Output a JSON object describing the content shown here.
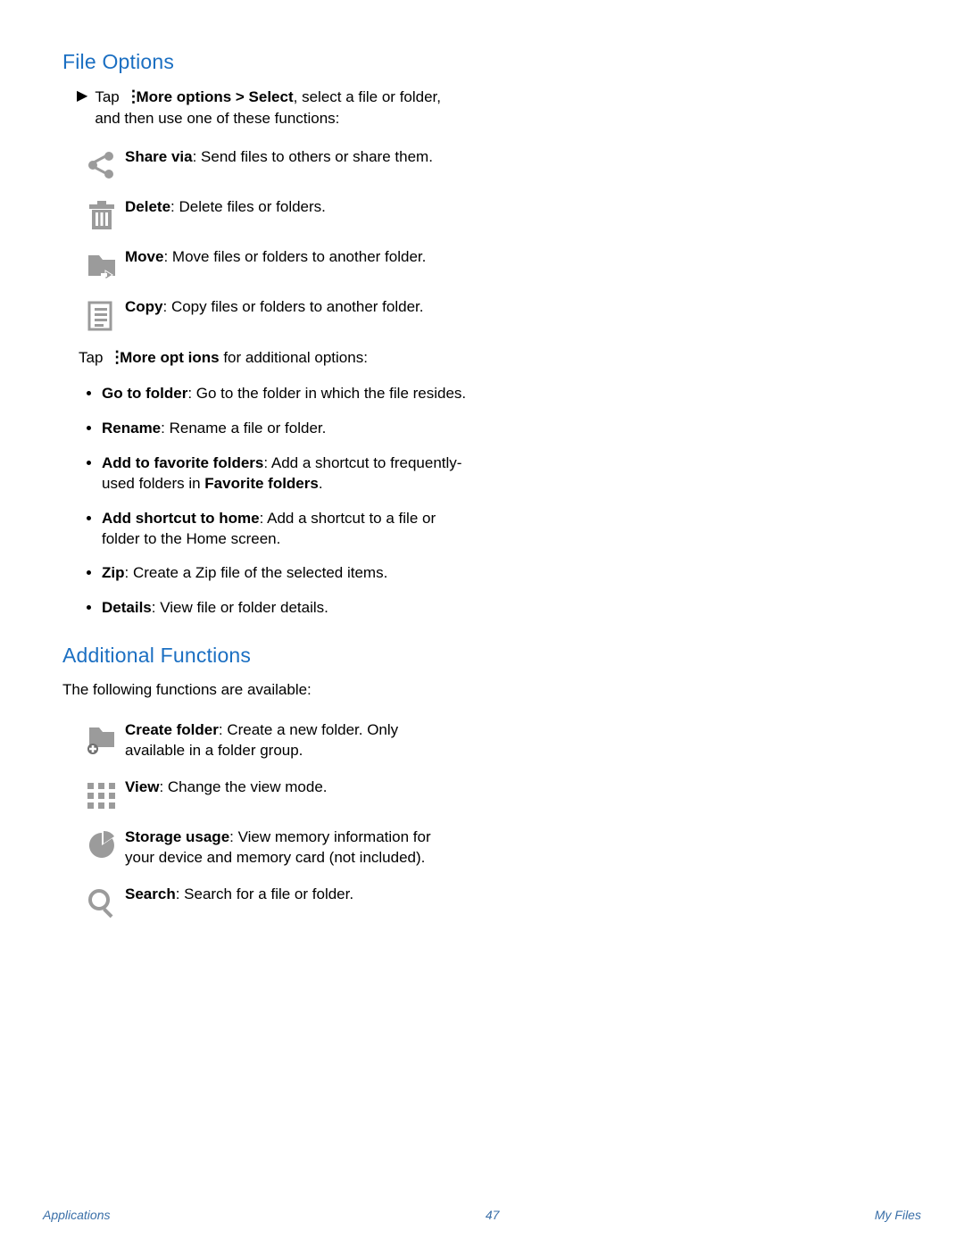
{
  "section1": {
    "heading": "File Options",
    "intro_prefix": "Tap ",
    "intro_bold": "More options > Select",
    "intro_suffix": ", select a file or folder, and then use one of these functions:",
    "items": [
      {
        "icon": "share",
        "bold": "Share via",
        "text": ": Send files to others or share them."
      },
      {
        "icon": "delete",
        "bold": "Delete",
        "text": ": Delete files or folders."
      },
      {
        "icon": "move",
        "bold": "Move",
        "text": ": Move files or folders to another folder."
      },
      {
        "icon": "copy",
        "bold": "Copy",
        "text": ": Copy files or folders to another folder."
      }
    ],
    "subintro_prefix": "Tap ",
    "subintro_bold": "More opt ions",
    "subintro_suffix": " for additional options:",
    "bullets": [
      {
        "bold": "Go to folder",
        "text": ": Go to the folder in which the file resides."
      },
      {
        "bold": "Rename",
        "text": ": Rename a file or folder."
      },
      {
        "bold": "Add to favorite folders",
        "text": ": Add a shortcut to frequently-used folders in ",
        "tail_bold": "Favorite folders",
        "tail": "."
      },
      {
        "bold": "Add shortcut to home",
        "text": ": Add a shortcut to a file or folder to the Home screen."
      },
      {
        "bold": "Zip",
        "text": ": Create a Zip file of the selected items."
      },
      {
        "bold": "Details",
        "text": ": View file or folder details."
      }
    ]
  },
  "section2": {
    "heading": "Additional Functions",
    "intro": "The following functions are available:",
    "items": [
      {
        "icon": "createfolder",
        "bold": "Create folder",
        "text": ": Create a new folder. Only available in a folder group."
      },
      {
        "icon": "view",
        "bold": "View",
        "text": ": Change the view mode."
      },
      {
        "icon": "storage",
        "bold": "Storage usage",
        "text": ": View memory information for your device and memory card (not included)."
      },
      {
        "icon": "search",
        "bold": "Search",
        "text": ": Search for a file or folder."
      }
    ]
  },
  "footer": {
    "left": "Applications",
    "center": "47",
    "right": "My Files"
  }
}
